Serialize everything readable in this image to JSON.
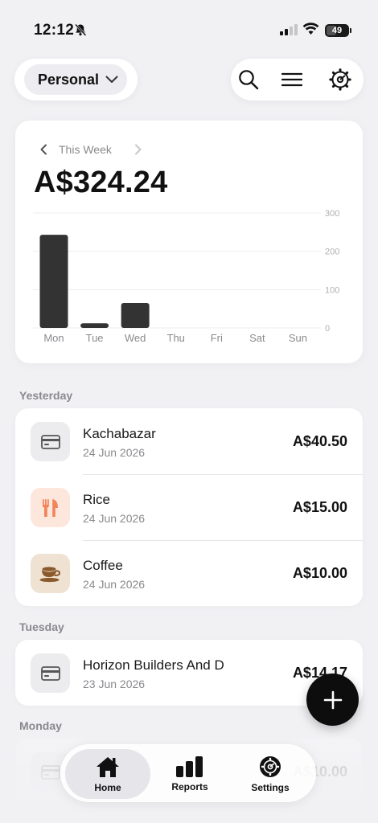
{
  "status_bar": {
    "time": "12:12",
    "battery": "49"
  },
  "header": {
    "profile_label": "Personal"
  },
  "summary": {
    "period_label": "This Week",
    "total": "A$324.24"
  },
  "chart_data": {
    "type": "bar",
    "categories": [
      "Mon",
      "Tue",
      "Wed",
      "Thu",
      "Fri",
      "Sat",
      "Sun"
    ],
    "values": [
      243,
      12,
      65,
      0,
      0,
      0,
      0
    ],
    "ylim": [
      0,
      300
    ],
    "yticks": [
      0,
      100,
      200,
      300
    ],
    "grid": true,
    "colors": {
      "bar": "#333333",
      "grid": "#eeeeee"
    }
  },
  "sections": [
    {
      "title": "Yesterday",
      "transactions": [
        {
          "name": "Kachabazar",
          "date": "24 Jun 2026",
          "amount": "A$40.50",
          "icon": "card-icon"
        },
        {
          "name": "Rice",
          "date": "24 Jun 2026",
          "amount": "A$15.00",
          "icon": "fork-knife-icon"
        },
        {
          "name": "Coffee",
          "date": "24 Jun 2026",
          "amount": "A$10.00",
          "icon": "coffee-icon"
        }
      ]
    },
    {
      "title": "Tuesday",
      "transactions": [
        {
          "name": "Horizon Builders And D",
          "date": "23 Jun 2026",
          "amount": "A$14.17",
          "icon": "card-icon"
        }
      ]
    },
    {
      "title": "Monday",
      "transactions": [
        {
          "name": "",
          "date": "",
          "amount": "A$10.00",
          "icon": "card-icon"
        }
      ]
    }
  ],
  "tabbar": {
    "home": "Home",
    "reports": "Reports",
    "settings": "Settings"
  },
  "colors": {
    "background": "#f1f1f4",
    "card_icon_bg": "#ececee",
    "food_icon_bg": "#fde7dc",
    "food_icon": "#f0845a",
    "coffee_icon_bg": "#f0e2d3",
    "coffee_icon": "#8a5a2b"
  }
}
